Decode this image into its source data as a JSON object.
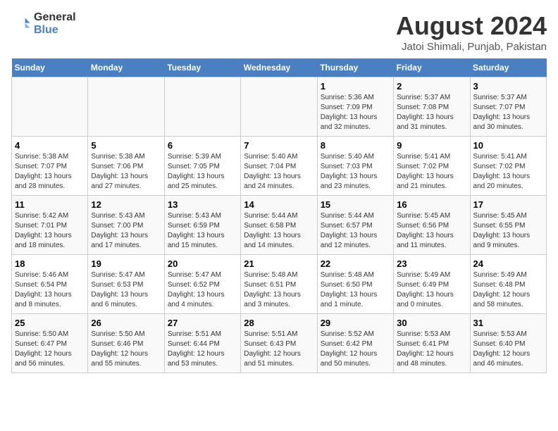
{
  "logo": {
    "text_general": "General",
    "text_blue": "Blue"
  },
  "title": "August 2024",
  "subtitle": "Jatoi Shimali, Punjab, Pakistan",
  "days_of_week": [
    "Sunday",
    "Monday",
    "Tuesday",
    "Wednesday",
    "Thursday",
    "Friday",
    "Saturday"
  ],
  "weeks": [
    [
      {
        "day": "",
        "info": ""
      },
      {
        "day": "",
        "info": ""
      },
      {
        "day": "",
        "info": ""
      },
      {
        "day": "",
        "info": ""
      },
      {
        "day": "1",
        "info": "Sunrise: 5:36 AM\nSunset: 7:09 PM\nDaylight: 13 hours\nand 32 minutes."
      },
      {
        "day": "2",
        "info": "Sunrise: 5:37 AM\nSunset: 7:08 PM\nDaylight: 13 hours\nand 31 minutes."
      },
      {
        "day": "3",
        "info": "Sunrise: 5:37 AM\nSunset: 7:07 PM\nDaylight: 13 hours\nand 30 minutes."
      }
    ],
    [
      {
        "day": "4",
        "info": "Sunrise: 5:38 AM\nSunset: 7:07 PM\nDaylight: 13 hours\nand 28 minutes."
      },
      {
        "day": "5",
        "info": "Sunrise: 5:38 AM\nSunset: 7:06 PM\nDaylight: 13 hours\nand 27 minutes."
      },
      {
        "day": "6",
        "info": "Sunrise: 5:39 AM\nSunset: 7:05 PM\nDaylight: 13 hours\nand 25 minutes."
      },
      {
        "day": "7",
        "info": "Sunrise: 5:40 AM\nSunset: 7:04 PM\nDaylight: 13 hours\nand 24 minutes."
      },
      {
        "day": "8",
        "info": "Sunrise: 5:40 AM\nSunset: 7:03 PM\nDaylight: 13 hours\nand 23 minutes."
      },
      {
        "day": "9",
        "info": "Sunrise: 5:41 AM\nSunset: 7:02 PM\nDaylight: 13 hours\nand 21 minutes."
      },
      {
        "day": "10",
        "info": "Sunrise: 5:41 AM\nSunset: 7:02 PM\nDaylight: 13 hours\nand 20 minutes."
      }
    ],
    [
      {
        "day": "11",
        "info": "Sunrise: 5:42 AM\nSunset: 7:01 PM\nDaylight: 13 hours\nand 18 minutes."
      },
      {
        "day": "12",
        "info": "Sunrise: 5:43 AM\nSunset: 7:00 PM\nDaylight: 13 hours\nand 17 minutes."
      },
      {
        "day": "13",
        "info": "Sunrise: 5:43 AM\nSunset: 6:59 PM\nDaylight: 13 hours\nand 15 minutes."
      },
      {
        "day": "14",
        "info": "Sunrise: 5:44 AM\nSunset: 6:58 PM\nDaylight: 13 hours\nand 14 minutes."
      },
      {
        "day": "15",
        "info": "Sunrise: 5:44 AM\nSunset: 6:57 PM\nDaylight: 13 hours\nand 12 minutes."
      },
      {
        "day": "16",
        "info": "Sunrise: 5:45 AM\nSunset: 6:56 PM\nDaylight: 13 hours\nand 11 minutes."
      },
      {
        "day": "17",
        "info": "Sunrise: 5:45 AM\nSunset: 6:55 PM\nDaylight: 13 hours\nand 9 minutes."
      }
    ],
    [
      {
        "day": "18",
        "info": "Sunrise: 5:46 AM\nSunset: 6:54 PM\nDaylight: 13 hours\nand 8 minutes."
      },
      {
        "day": "19",
        "info": "Sunrise: 5:47 AM\nSunset: 6:53 PM\nDaylight: 13 hours\nand 6 minutes."
      },
      {
        "day": "20",
        "info": "Sunrise: 5:47 AM\nSunset: 6:52 PM\nDaylight: 13 hours\nand 4 minutes."
      },
      {
        "day": "21",
        "info": "Sunrise: 5:48 AM\nSunset: 6:51 PM\nDaylight: 13 hours\nand 3 minutes."
      },
      {
        "day": "22",
        "info": "Sunrise: 5:48 AM\nSunset: 6:50 PM\nDaylight: 13 hours\nand 1 minute."
      },
      {
        "day": "23",
        "info": "Sunrise: 5:49 AM\nSunset: 6:49 PM\nDaylight: 13 hours\nand 0 minutes."
      },
      {
        "day": "24",
        "info": "Sunrise: 5:49 AM\nSunset: 6:48 PM\nDaylight: 12 hours\nand 58 minutes."
      }
    ],
    [
      {
        "day": "25",
        "info": "Sunrise: 5:50 AM\nSunset: 6:47 PM\nDaylight: 12 hours\nand 56 minutes."
      },
      {
        "day": "26",
        "info": "Sunrise: 5:50 AM\nSunset: 6:46 PM\nDaylight: 12 hours\nand 55 minutes."
      },
      {
        "day": "27",
        "info": "Sunrise: 5:51 AM\nSunset: 6:44 PM\nDaylight: 12 hours\nand 53 minutes."
      },
      {
        "day": "28",
        "info": "Sunrise: 5:51 AM\nSunset: 6:43 PM\nDaylight: 12 hours\nand 51 minutes."
      },
      {
        "day": "29",
        "info": "Sunrise: 5:52 AM\nSunset: 6:42 PM\nDaylight: 12 hours\nand 50 minutes."
      },
      {
        "day": "30",
        "info": "Sunrise: 5:53 AM\nSunset: 6:41 PM\nDaylight: 12 hours\nand 48 minutes."
      },
      {
        "day": "31",
        "info": "Sunrise: 5:53 AM\nSunset: 6:40 PM\nDaylight: 12 hours\nand 46 minutes."
      }
    ]
  ]
}
